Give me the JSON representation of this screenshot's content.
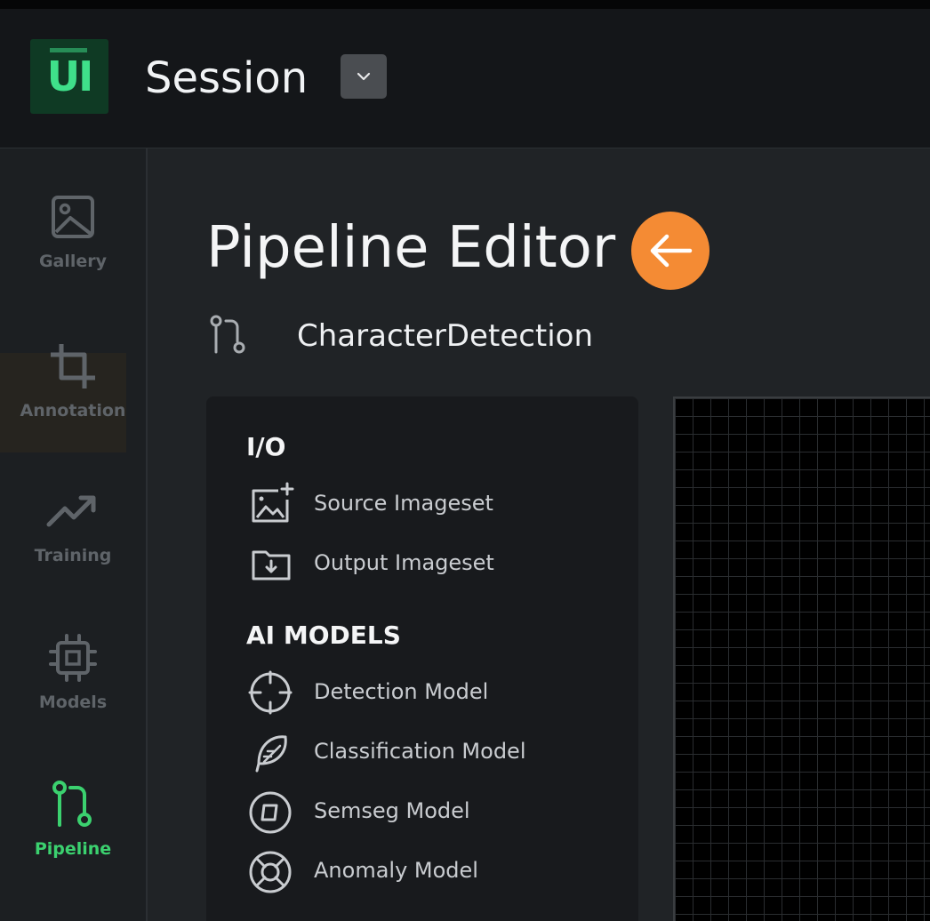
{
  "app": {
    "logo_text": "UI",
    "session_label": "Session"
  },
  "sidebar": {
    "items": [
      {
        "label": "Gallery",
        "icon": "image-icon"
      },
      {
        "label": "Annotation",
        "icon": "crop-icon"
      },
      {
        "label": "Training",
        "icon": "trending-up-icon"
      },
      {
        "label": "Models",
        "icon": "chip-icon"
      },
      {
        "label": "Pipeline",
        "icon": "pipeline-icon",
        "active": true
      }
    ]
  },
  "main": {
    "title": "Pipeline Editor",
    "pipeline_name": "CharacterDetection"
  },
  "palette": {
    "sections": [
      {
        "title": "I/O",
        "items": [
          {
            "label": "Source Imageset",
            "icon": "add-image-icon"
          },
          {
            "label": "Output Imageset",
            "icon": "folder-download-icon"
          }
        ]
      },
      {
        "title": "AI MODELS",
        "items": [
          {
            "label": "Detection Model",
            "icon": "crosshair-icon"
          },
          {
            "label": "Classification Model",
            "icon": "feather-icon"
          },
          {
            "label": "Semseg Model",
            "icon": "shape-circle-icon"
          },
          {
            "label": "Anomaly Model",
            "icon": "lifebuoy-icon"
          }
        ]
      }
    ]
  },
  "colors": {
    "accent_green": "#3bd16f",
    "accent_orange": "#f48b34",
    "background": "#202326"
  }
}
